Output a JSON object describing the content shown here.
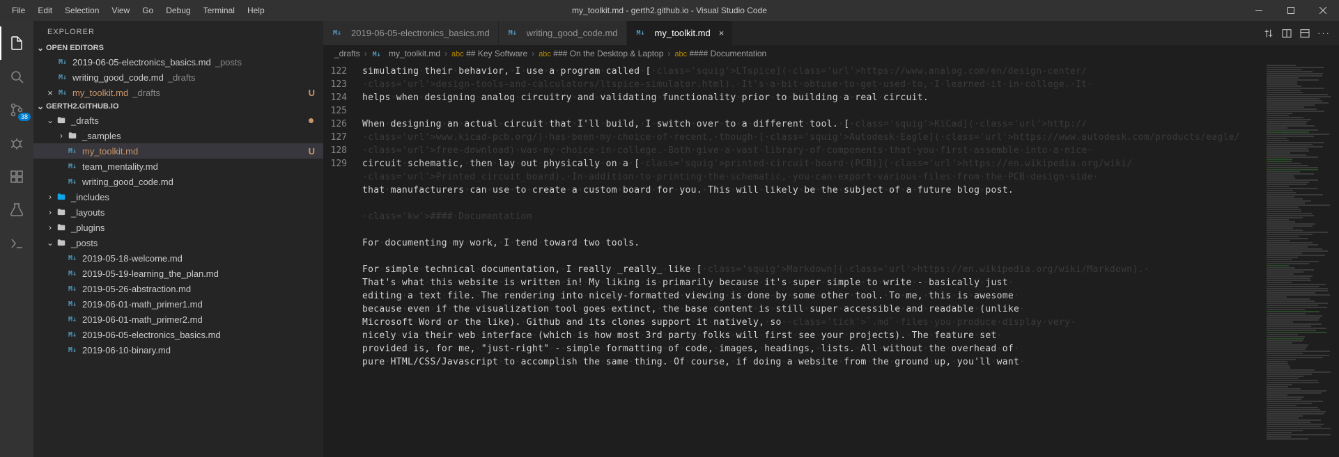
{
  "titlebar": {
    "menu": [
      "File",
      "Edit",
      "Selection",
      "View",
      "Go",
      "Debug",
      "Terminal",
      "Help"
    ],
    "title": "my_toolkit.md - gerth2.github.io - Visual Studio Code"
  },
  "activitybar": {
    "items": [
      {
        "name": "explorer-icon",
        "active": true
      },
      {
        "name": "search-icon",
        "active": false
      },
      {
        "name": "source-control-icon",
        "active": false,
        "badge": "38"
      },
      {
        "name": "debug-icon",
        "active": false
      },
      {
        "name": "extensions-icon",
        "active": false
      },
      {
        "name": "test-icon",
        "active": false
      },
      {
        "name": "terminal-icon",
        "active": false
      }
    ]
  },
  "sidebar": {
    "title": "EXPLORER",
    "open_editors_title": "OPEN EDITORS",
    "open_editors": [
      {
        "icon": "M↓",
        "label": "2019-06-05-electronics_basics.md",
        "hint": "_posts"
      },
      {
        "icon": "M↓",
        "label": "writing_good_code.md",
        "hint": "_drafts"
      },
      {
        "icon": "M↓",
        "label": "my_toolkit.md",
        "hint": "_drafts",
        "active": true,
        "modified": true,
        "status": "U"
      }
    ],
    "project_title": "GERTH2.GITHUB.IO",
    "tree": [
      {
        "type": "folder",
        "label": "_drafts",
        "depth": 0,
        "expanded": true,
        "modDot": true
      },
      {
        "type": "folder",
        "label": "_samples",
        "depth": 1,
        "expanded": false
      },
      {
        "type": "file",
        "icon": "M↓",
        "label": "my_toolkit.md",
        "depth": 1,
        "selected": true,
        "status": "U",
        "modified": true
      },
      {
        "type": "file",
        "icon": "M↓",
        "label": "team_mentality.md",
        "depth": 1
      },
      {
        "type": "file",
        "icon": "M↓",
        "label": "writing_good_code.md",
        "depth": 1
      },
      {
        "type": "folder",
        "label": "_includes",
        "depth": 0,
        "expanded": false,
        "accent": true
      },
      {
        "type": "folder",
        "label": "_layouts",
        "depth": 0,
        "expanded": false
      },
      {
        "type": "folder",
        "label": "_plugins",
        "depth": 0,
        "expanded": false
      },
      {
        "type": "folder",
        "label": "_posts",
        "depth": 0,
        "expanded": true
      },
      {
        "type": "file",
        "icon": "M↓",
        "label": "2019-05-18-welcome.md",
        "depth": 1
      },
      {
        "type": "file",
        "icon": "M↓",
        "label": "2019-05-19-learning_the_plan.md",
        "depth": 1
      },
      {
        "type": "file",
        "icon": "M↓",
        "label": "2019-05-26-abstraction.md",
        "depth": 1
      },
      {
        "type": "file",
        "icon": "M↓",
        "label": "2019-06-01-math_primer1.md",
        "depth": 1
      },
      {
        "type": "file",
        "icon": "M↓",
        "label": "2019-06-01-math_primer2.md",
        "depth": 1
      },
      {
        "type": "file",
        "icon": "M↓",
        "label": "2019-06-05-electronics_basics.md",
        "depth": 1
      },
      {
        "type": "file",
        "icon": "M↓",
        "label": "2019-06-10-binary.md",
        "depth": 1
      }
    ]
  },
  "tabs": [
    {
      "icon": "M↓",
      "label": "2019-06-05-electronics_basics.md"
    },
    {
      "icon": "M↓",
      "label": "writing_good_code.md"
    },
    {
      "icon": "M↓",
      "label": "my_toolkit.md",
      "active": true,
      "close": true
    }
  ],
  "breadcrumbs": [
    {
      "text": "_drafts"
    },
    {
      "icon": "M↓",
      "text": "my_toolkit.md"
    },
    {
      "abc": true,
      "text": "## Key Software"
    },
    {
      "abc": true,
      "text": "### On the Desktop & Laptop"
    },
    {
      "abc": true,
      "text": "#### Documentation"
    }
  ],
  "editor": {
    "lines": [
      {
        "n": "",
        "html": "simulating their behavior, I use a program called [<span class='squig'>LTspice</span>](<span class='url'>https://www.analog.com/en/design-center/</span>"
      },
      {
        "n": "",
        "html": "<span class='url'>design-tools-and-calculators/ltspice-simulator.html</span>). It's a bit obtuse to get used to, I learned it in college. It "
      },
      {
        "n": "",
        "html": "helps when designing analog circuitry and validating functionality prior to building a real circuit."
      },
      {
        "n": "122",
        "html": ""
      },
      {
        "n": "123",
        "html": "When designing an actual circuit that I'll build, I switch over to a different tool. [<span class='squig'>KiCad</span>](<span class='url'>http://</span>"
      },
      {
        "n": "",
        "html": "<span class='url'>www.kicad-pcb.org/</span>) has been my choice of recent, though [<span class='squig'>Autodesk Eagle</span>](<span class='url'>https://www.autodesk.com/products/eagle/</span>"
      },
      {
        "n": "",
        "html": "<span class='url'>free-download</span>) was my choice in college. Both give a vast library of components that you first assemble into a nice "
      },
      {
        "n": "",
        "html": "circuit schematic, then lay out physically on a [<span class='squig'>printed circuit board (PCB)</span>](<span class='url'>https://en.wikipedia.org/wiki/</span>"
      },
      {
        "n": "",
        "html": "<span class='url'>Printed_circuit_board</span>). In addition to printing the schematic, you can export various files from the PCB design side "
      },
      {
        "n": "",
        "html": "that manufacturers can use to create a custom board for you. This will likely be the subject of a future blog post."
      },
      {
        "n": "124",
        "html": ""
      },
      {
        "n": "125",
        "html": "<span class='kw'>#### Documentation</span>"
      },
      {
        "n": "126",
        "html": ""
      },
      {
        "n": "127",
        "html": "For documenting my work, I tend toward two tools."
      },
      {
        "n": "128",
        "html": ""
      },
      {
        "n": "129",
        "html": "For simple technical documentation, I really _really_ like [<span class='squig'>Markdown</span>](<span class='url'>https://en.wikipedia.org/wiki/Markdown</span>). "
      },
      {
        "n": "",
        "html": "That's what this website is written in! My liking is primarily because it's super simple to write - basically just "
      },
      {
        "n": "",
        "html": "editing a text file. The rendering into nicely-formatted viewing is done by some other tool. To me, this is awesome "
      },
      {
        "n": "",
        "html": "because even if the visualization tool goes extinct, the base content is still super accessible and readable (unlike "
      },
      {
        "n": "",
        "html": "Microsoft Word or the like). Github and its clones support it natively, so <span class='tick'>`.md`</span> files you produce display very "
      },
      {
        "n": "",
        "html": "nicely via their web interface (which is how most 3rd party folks will first see your projects). The feature set "
      },
      {
        "n": "",
        "html": "provided is, for me, \"just-right\" - simple formatting of code, images, headings, lists. All without the overhead of "
      },
      {
        "n": "",
        "html": "pure HTML/CSS/Javascript to accomplish the same thing. Of course, if doing a website from the ground up, you'll want "
      }
    ]
  }
}
